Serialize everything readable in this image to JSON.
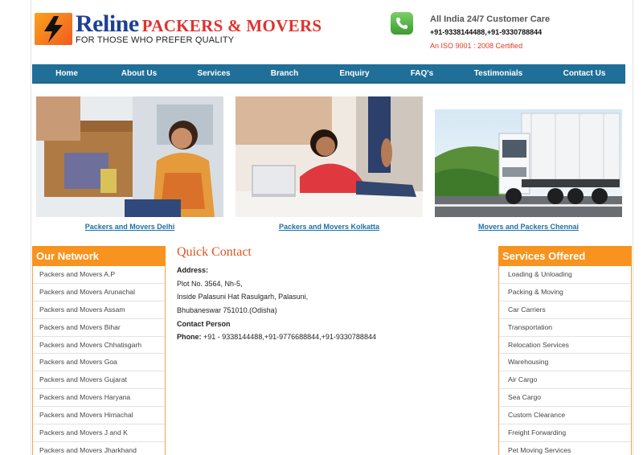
{
  "header": {
    "brand_main": "Reline",
    "brand_sub": "PACKERS & MOVERS",
    "tagline": "FOR THOSE WHO PREFER QUALITY",
    "care_title": "All India 24/7 Customer Care",
    "care_phones": "+91-9338144488,+91-9330788844",
    "iso": "An ISO 9001 : 2008 Certified"
  },
  "nav": [
    "Home",
    "About Us",
    "Services",
    "Branch",
    "Enquiry",
    "FAQ's",
    "Testimonials",
    "Contact Us"
  ],
  "photos": [
    {
      "caption": "Packers and Movers Delhi"
    },
    {
      "caption": "Packers and Movers Kolkatta"
    },
    {
      "caption": "Movers and Packers Chennai"
    }
  ],
  "network": {
    "title": "Our Network",
    "items": [
      "Packers and Movers A.P",
      "Packers and Movers Arunachal",
      "Packers and Movers Assam",
      "Packers and Movers Bihar",
      "Packers and Movers Chhatisgarh",
      "Packers and Movers Goa",
      "Packers and Movers Gujarat",
      "Packers and Movers Haryana",
      "Packers and Movers Himachal",
      "Packers and Movers J and K",
      "Packers and Movers Jharkhand"
    ]
  },
  "quick_contact": {
    "title": "Quick Contact",
    "address_label": "Address:",
    "address_lines": [
      "Plot No. 3564, Nh-5,",
      "Inside Palasuni Hat Rasulgarh, Palasuni,",
      "Bhubaneswar 751010.(Odisha)"
    ],
    "contact_label": "Contact Person",
    "phone_label": "Phone:",
    "phone_value": " +91 - 9338144488,+91-9776688844,+91-9330788844"
  },
  "services": {
    "title": "Services Offered",
    "items": [
      "Loading & Unloading",
      "Packing & Moving",
      "Car Carriers",
      "Transportation",
      "Relocation Services",
      "Warehousing",
      "Air Cargo",
      "Sea Cargo",
      "Custom Clearance",
      "Freight Forwarding",
      "Pet Moving Services"
    ]
  }
}
